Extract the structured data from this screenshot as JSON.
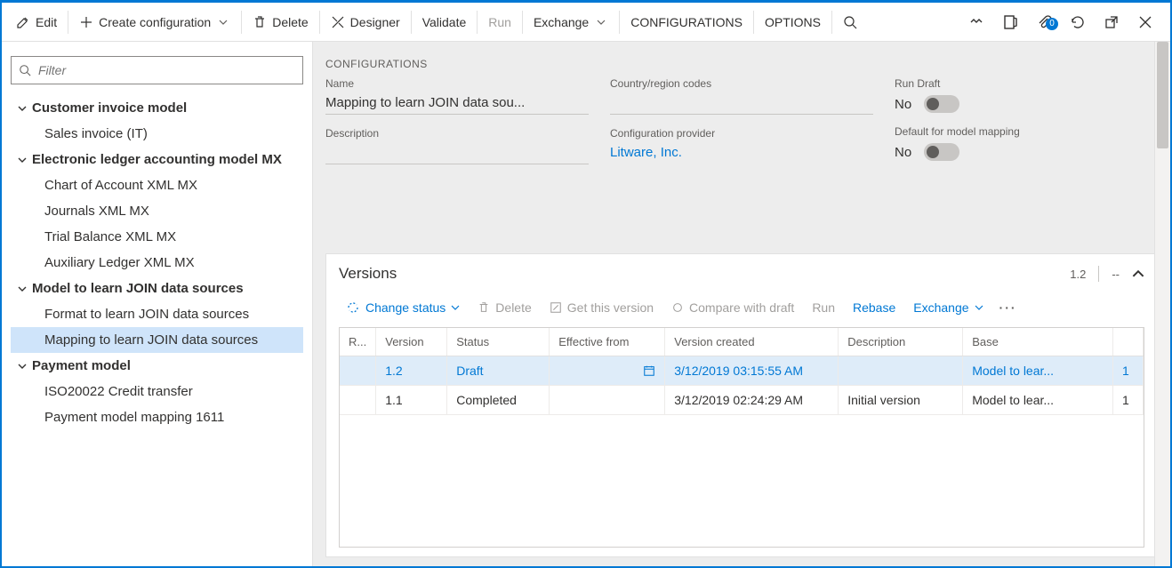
{
  "toolbar": {
    "edit": "Edit",
    "create": "Create configuration",
    "delete": "Delete",
    "designer": "Designer",
    "validate": "Validate",
    "run": "Run",
    "exchange": "Exchange",
    "configurations": "CONFIGURATIONS",
    "options": "OPTIONS",
    "attach_badge": "0"
  },
  "sidebar": {
    "filter_placeholder": "Filter",
    "nodes": [
      {
        "label": "Customer invoice model",
        "level": 0,
        "expanded": true
      },
      {
        "label": "Sales invoice (IT)",
        "level": 1
      },
      {
        "label": "Electronic ledger accounting model MX",
        "level": 0,
        "expanded": true
      },
      {
        "label": "Chart of Account XML MX",
        "level": 1
      },
      {
        "label": "Journals XML MX",
        "level": 1
      },
      {
        "label": "Trial Balance XML MX",
        "level": 1
      },
      {
        "label": "Auxiliary Ledger XML MX",
        "level": 1
      },
      {
        "label": "Model to learn JOIN data sources",
        "level": 0,
        "expanded": true
      },
      {
        "label": "Format to learn JOIN data sources",
        "level": 1
      },
      {
        "label": "Mapping to learn JOIN data sources",
        "level": 1,
        "selected": true
      },
      {
        "label": "Payment model",
        "level": 0,
        "expanded": true
      },
      {
        "label": "ISO20022 Credit transfer",
        "level": 1
      },
      {
        "label": "Payment model mapping 1611",
        "level": 1
      }
    ]
  },
  "details": {
    "header": "CONFIGURATIONS",
    "name_label": "Name",
    "name_value": "Mapping to learn JOIN data sou...",
    "description_label": "Description",
    "description_value": "",
    "country_label": "Country/region codes",
    "country_value": "",
    "provider_label": "Configuration provider",
    "provider_value": "Litware, Inc.",
    "rundraft_label": "Run Draft",
    "rundraft_value": "No",
    "default_label": "Default for model mapping",
    "default_value": "No"
  },
  "versions": {
    "title": "Versions",
    "header_version": "1.2",
    "header_extra": "--",
    "toolbar": {
      "change_status": "Change status",
      "delete": "Delete",
      "get_this_version": "Get this version",
      "compare": "Compare with draft",
      "run": "Run",
      "rebase": "Rebase",
      "exchange": "Exchange"
    },
    "columns": [
      "R...",
      "Version",
      "Status",
      "Effective from",
      "Version created",
      "Description",
      "Base",
      ""
    ],
    "rows": [
      {
        "r": "",
        "version": "1.2",
        "status": "Draft",
        "effective": "",
        "show_date_icon": true,
        "created": "3/12/2019 03:15:55 AM",
        "description": "",
        "base": "Model to lear...",
        "base_n": "1",
        "selected": true
      },
      {
        "r": "",
        "version": "1.1",
        "status": "Completed",
        "effective": "",
        "show_date_icon": false,
        "created": "3/12/2019 02:24:29 AM",
        "description": "Initial version",
        "base": "Model to lear...",
        "base_n": "1",
        "selected": false
      }
    ]
  }
}
